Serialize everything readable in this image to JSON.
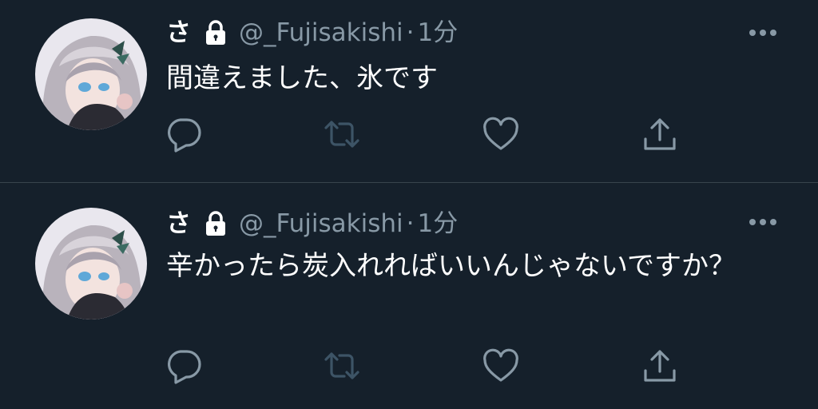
{
  "tweets": [
    {
      "display_name": "さ",
      "handle": "@_Fujisakishi",
      "separator": "·",
      "time": "1分",
      "text": "間違えました、氷です"
    },
    {
      "display_name": "さ",
      "handle": "@_Fujisakishi",
      "separator": "·",
      "time": "1分",
      "text": "辛かったら炭入れればいいんじゃないですか？"
    }
  ],
  "colors": {
    "background": "#15202b",
    "text_primary": "#ffffff",
    "text_secondary": "#8899a6",
    "divider": "#38444d",
    "retweet_disabled": "#3d5466"
  },
  "icons": {
    "lock": "lock-icon",
    "more": "more-icon",
    "reply": "reply-icon",
    "retweet": "retweet-icon",
    "like": "heart-icon",
    "share": "share-icon"
  }
}
